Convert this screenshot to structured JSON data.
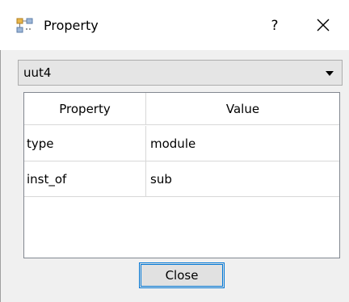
{
  "window": {
    "title": "Property",
    "help_label": "?",
    "icon": "property-tree-icon",
    "close_icon": "close-icon"
  },
  "selector": {
    "selected": "uut4"
  },
  "table": {
    "columns": [
      "Property",
      "Value"
    ],
    "rows": [
      [
        "type",
        "module"
      ],
      [
        "inst_of",
        "sub"
      ]
    ]
  },
  "footer": {
    "close_label": "Close"
  },
  "colors": {
    "accent": "#0078d7",
    "dialog_bg": "#f0f0f0",
    "combo_bg": "#e5e5e5"
  }
}
